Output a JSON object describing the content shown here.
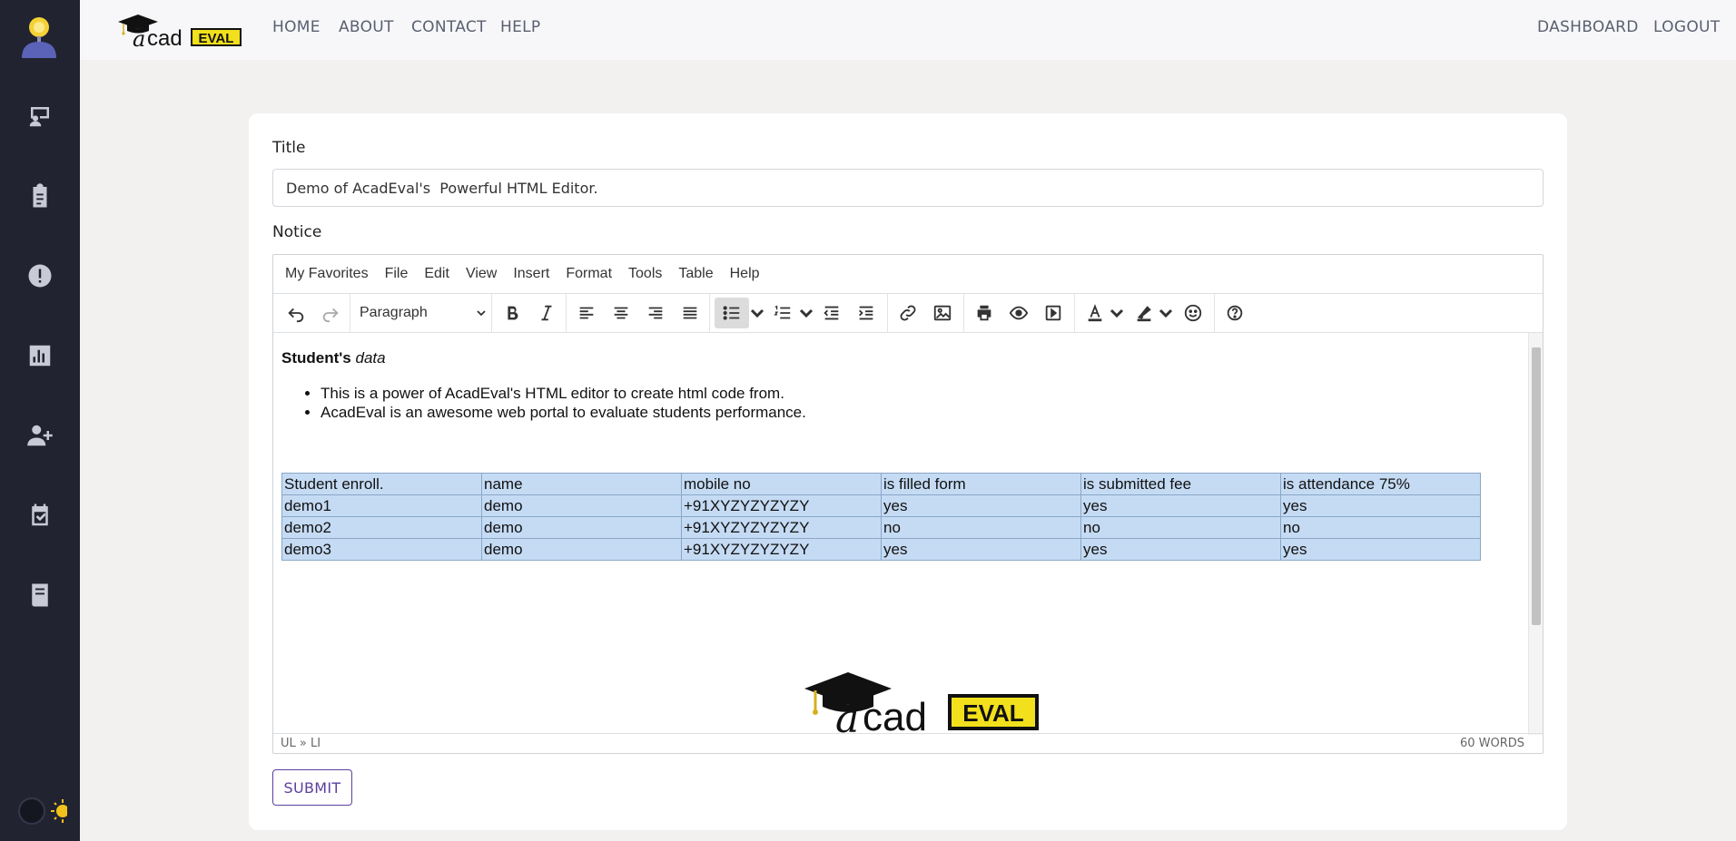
{
  "nav": {
    "home": "HOME",
    "about": "ABOUT",
    "contact": "CONTACT",
    "help": "HELP",
    "dashboard": "DASHBOARD",
    "logout": "LOGOUT"
  },
  "brand": {
    "part1": "cad",
    "part2": "EVAL"
  },
  "sidebar": {
    "icons": [
      "classroom-icon",
      "clipboard-icon",
      "alert-icon",
      "chart-icon",
      "add-user-icon",
      "calendar-check-icon",
      "book-icon"
    ]
  },
  "form": {
    "title_label": "Title",
    "title_value": "Demo of AcadEval's  Powerful HTML Editor.",
    "notice_label": "Notice",
    "submit_label": "SUBMIT"
  },
  "editor": {
    "menu": [
      "My Favorites",
      "File",
      "Edit",
      "View",
      "Insert",
      "Format",
      "Tools",
      "Table",
      "Help"
    ],
    "block_format": "Paragraph",
    "heading_bold": "Student's",
    "heading_italic": " data",
    "bullets": [
      "This is a power of AcadEval's HTML editor to create html code from.",
      "AcadEval is an awesome web portal to evaluate students performance."
    ],
    "table": [
      [
        "Student enroll.",
        "name",
        "mobile no",
        "is filled form",
        "is submitted fee",
        "is attendance 75%"
      ],
      [
        "demo1",
        "demo",
        "+91XYZYZYZYZY",
        "yes",
        "yes",
        "yes"
      ],
      [
        "demo2",
        "demo",
        "+91XYZYZYZYZY",
        "no",
        "no",
        "no"
      ],
      [
        "demo3",
        "demo",
        "+91XYZYZYZYZY",
        "yes",
        "yes",
        "yes"
      ]
    ],
    "path": "UL » LI",
    "word_count": "60 WORDS"
  },
  "colors": {
    "sidebar": "#212331",
    "accent": "#5b3fa0",
    "table_cell": "#c5dbf4",
    "brand_yellow": "#f2e01c"
  }
}
